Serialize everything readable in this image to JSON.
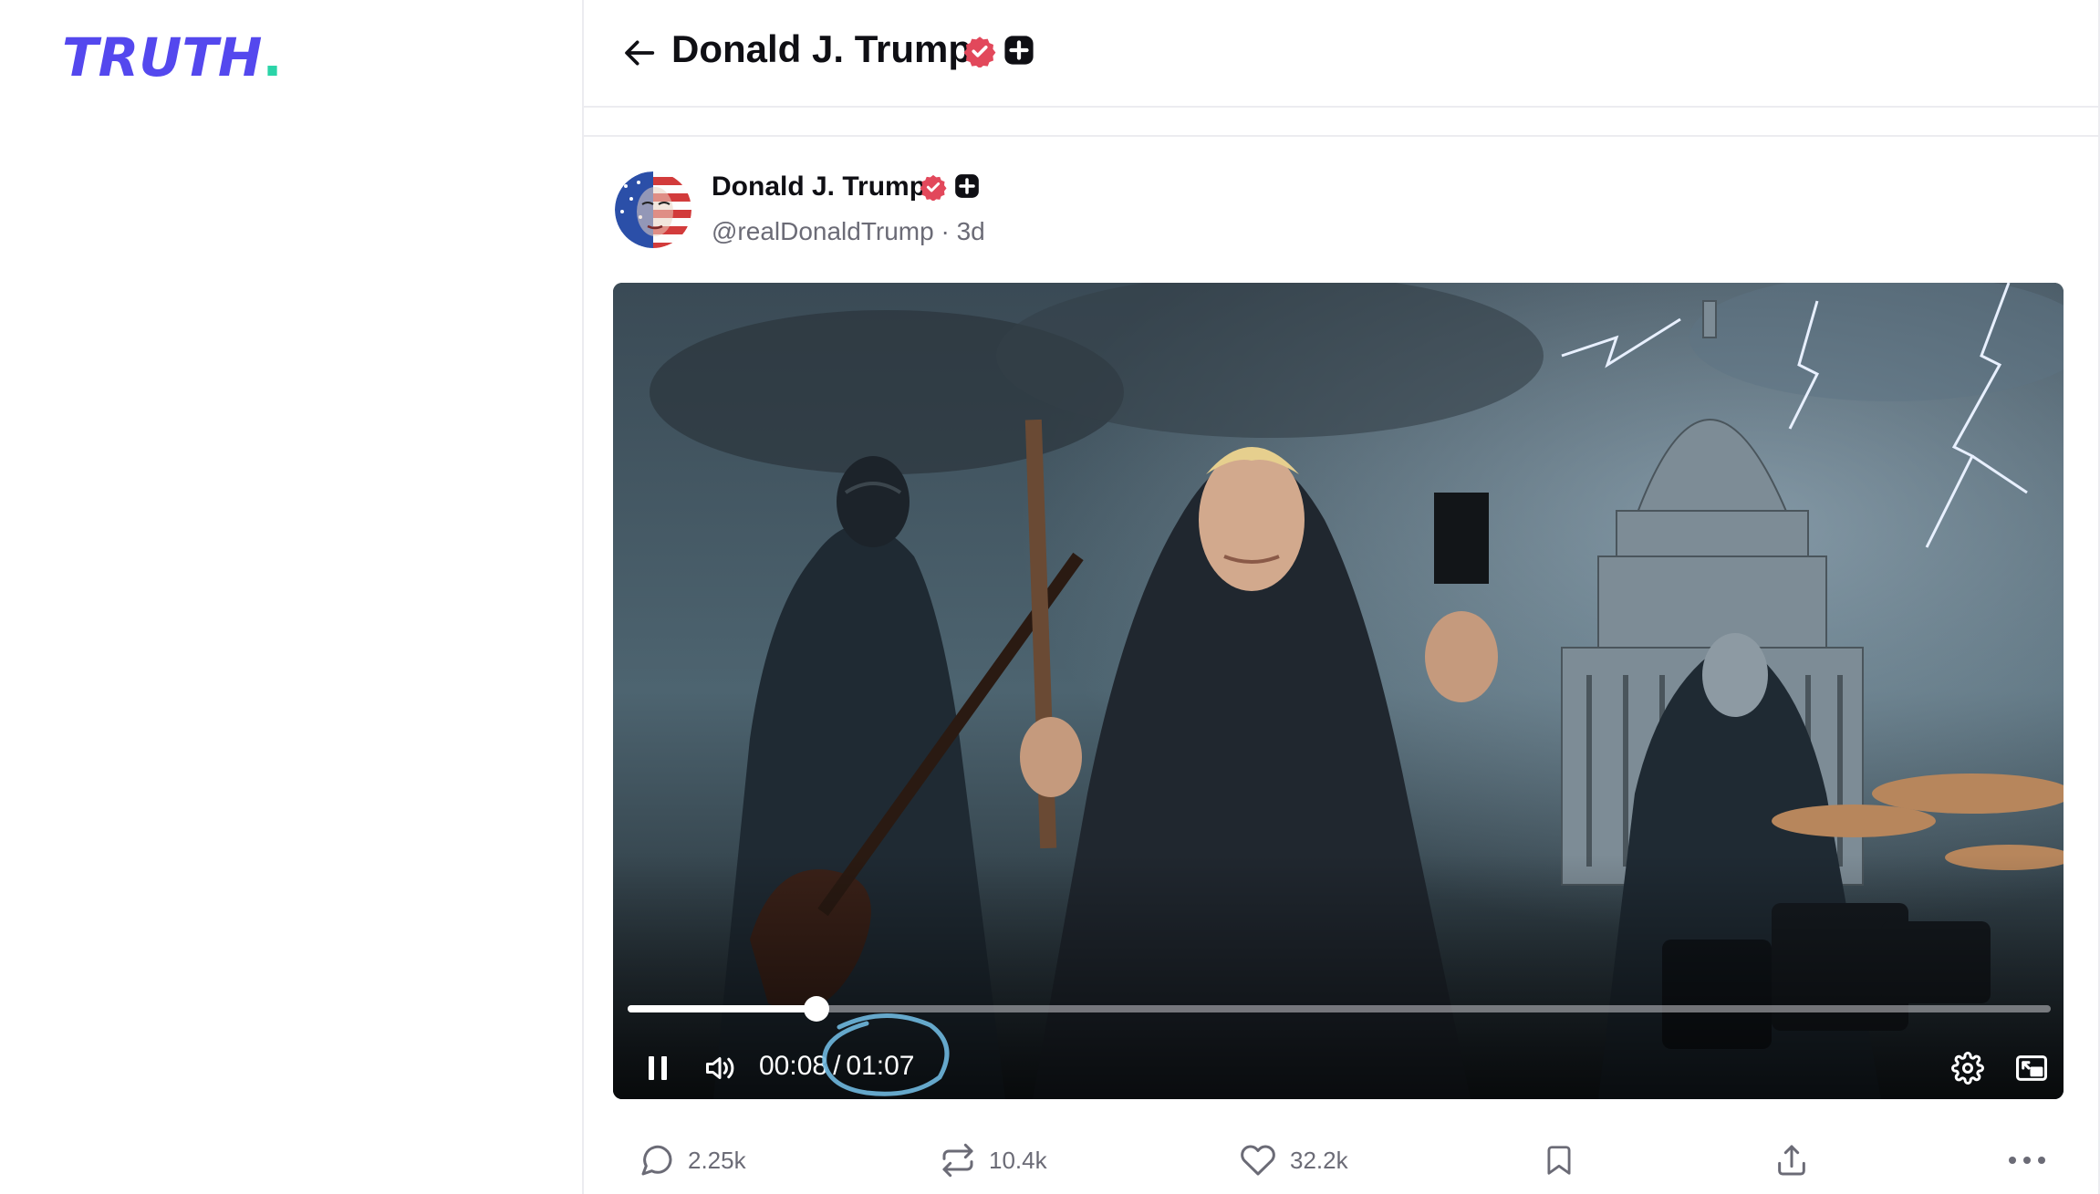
{
  "brand": {
    "logo_text": "TRUTH",
    "accent": "#5448ee",
    "dot_color": "#2bd4a8"
  },
  "header": {
    "title": "Donald J. Trump",
    "back_icon": "arrow-left-icon",
    "badges": [
      "verified-badge-icon",
      "plus-badge-icon"
    ]
  },
  "post": {
    "author_name": "Donald J. Trump",
    "handle": "@realDonaldTrump",
    "separator": "·",
    "time_ago": "3d",
    "verified_color": "#e2485b"
  },
  "video": {
    "current_time": "00:08",
    "time_separator": "/",
    "duration": "01:07",
    "progress_fraction": 0.133,
    "playing": true,
    "controls": [
      "pause-icon",
      "volume-icon",
      "settings-icon",
      "picture-in-picture-icon"
    ]
  },
  "actions": {
    "replies": "2.25k",
    "reposts": "10.4k",
    "likes": "32.2k",
    "icons": [
      "comment-icon",
      "repost-icon",
      "heart-icon",
      "bookmark-icon",
      "share-icon",
      "more-icon"
    ]
  }
}
